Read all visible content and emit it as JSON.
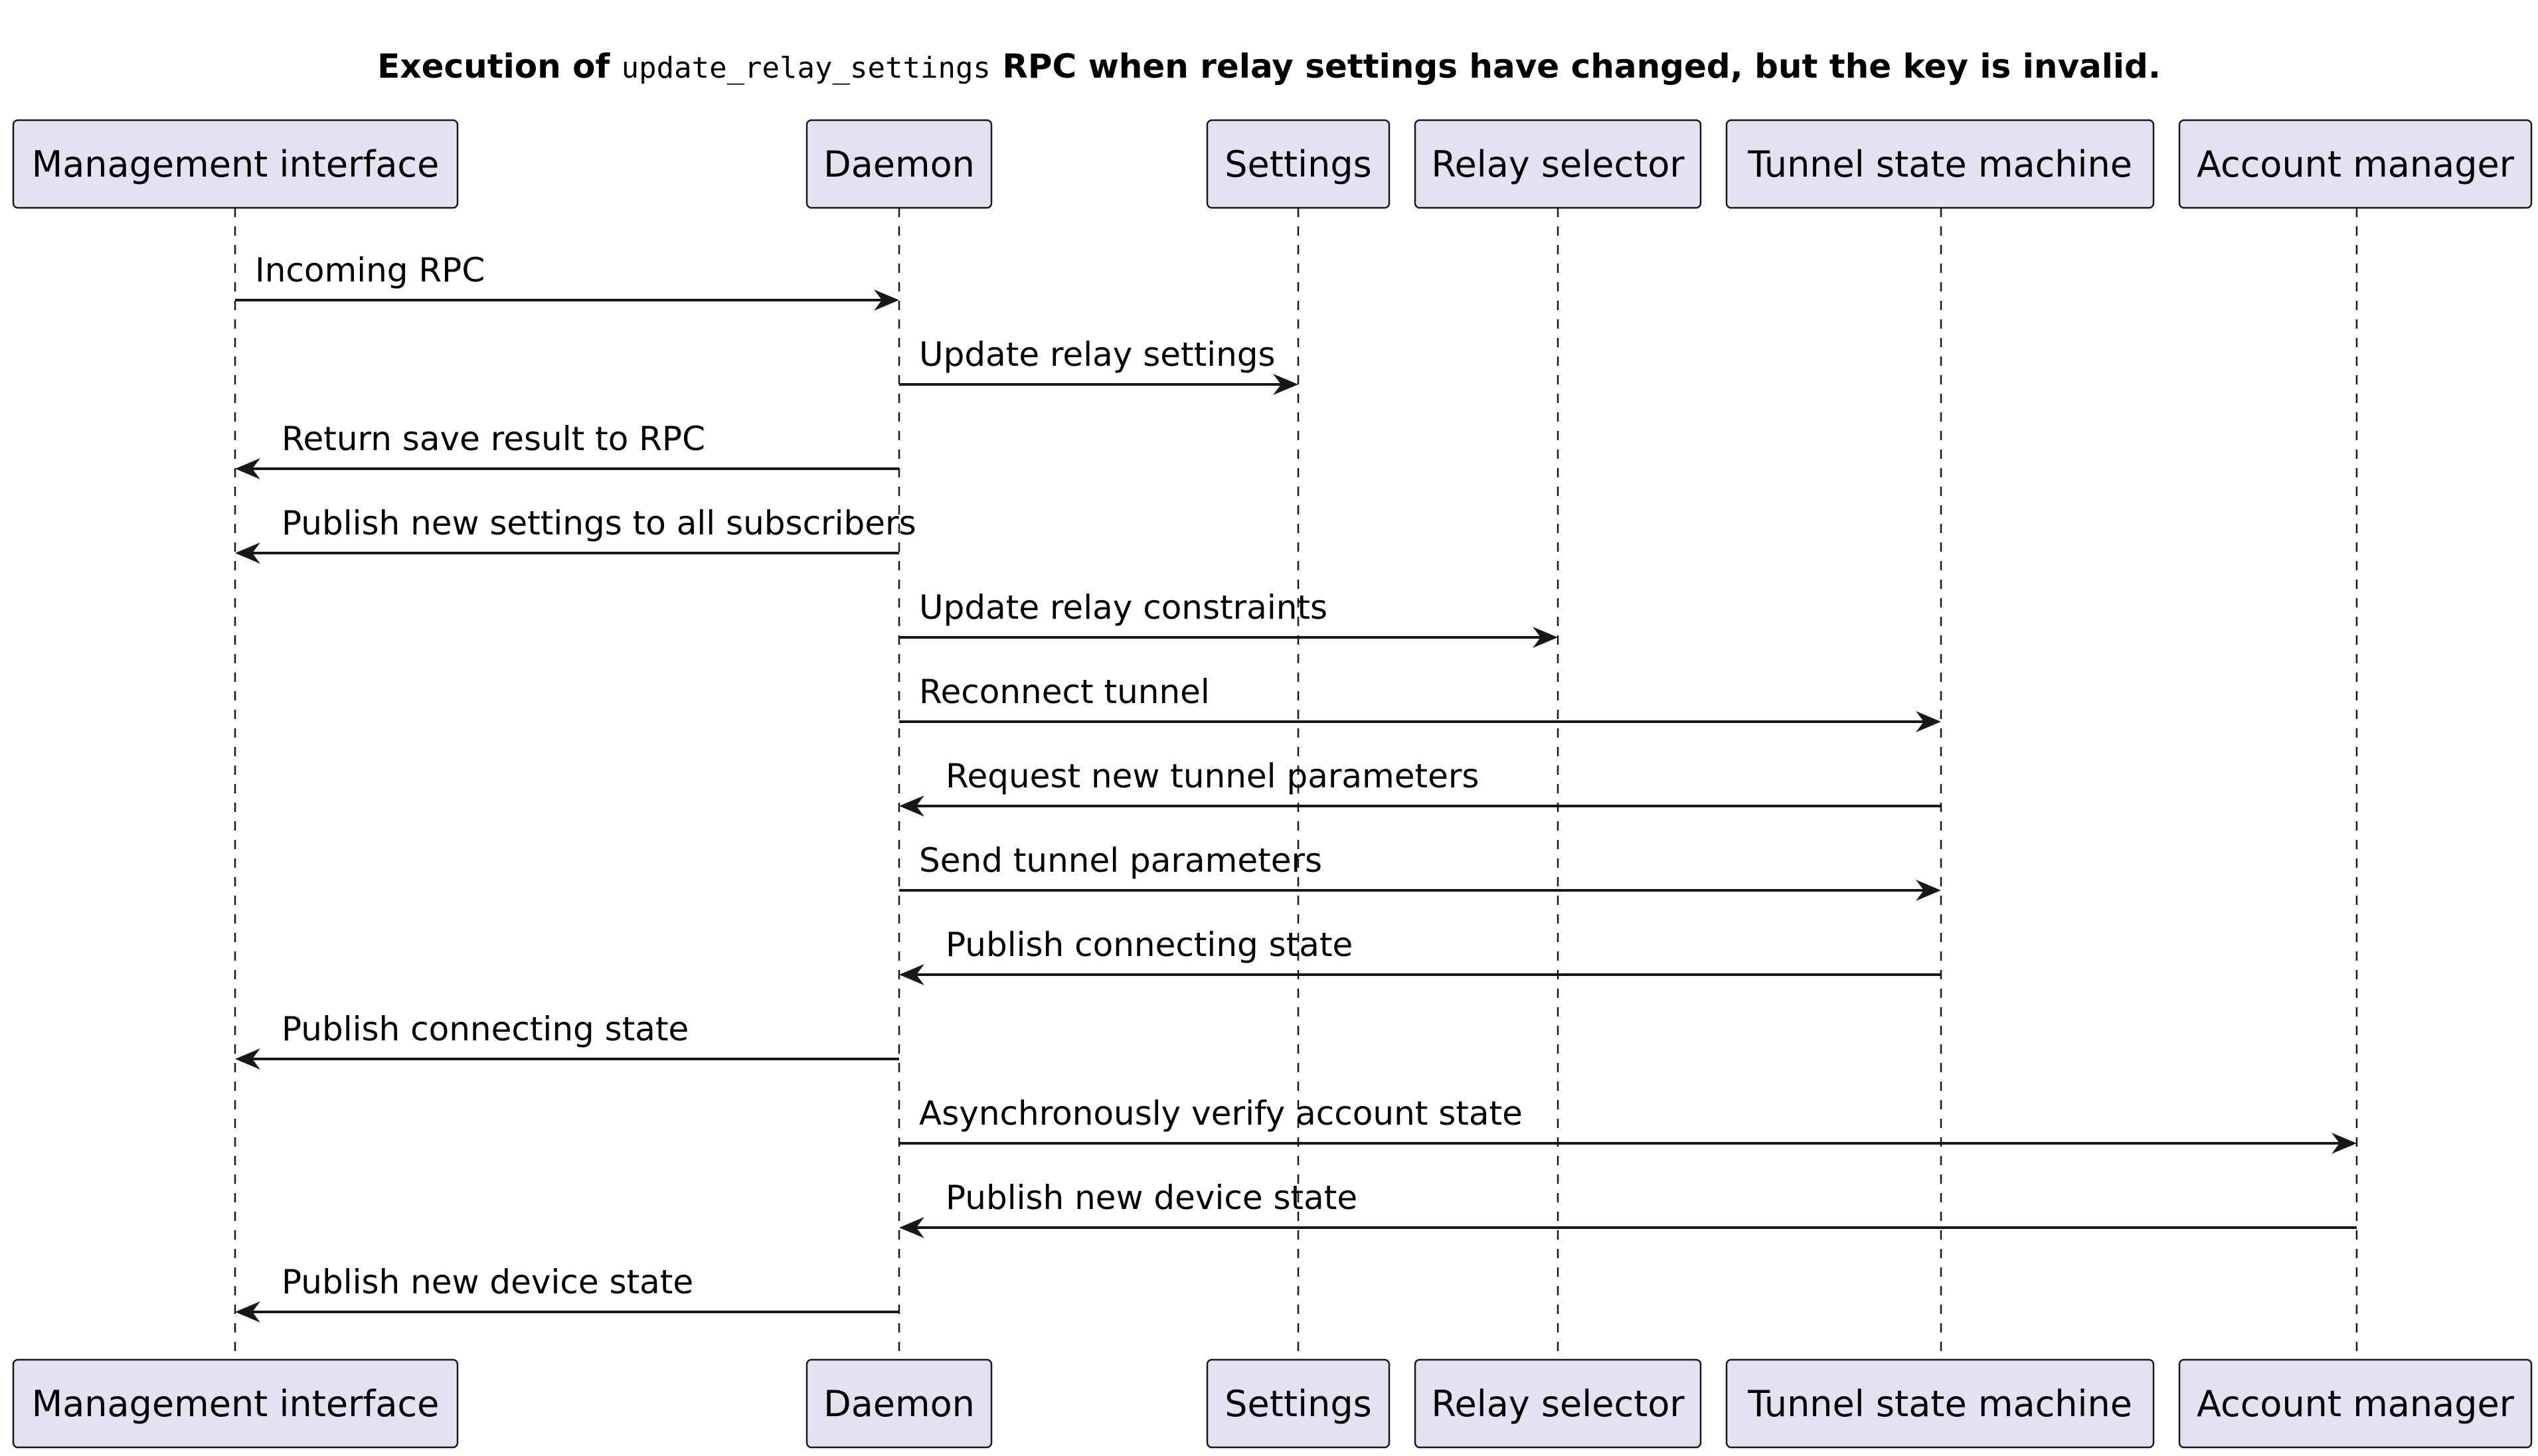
{
  "title": {
    "prefix": "Execution of ",
    "code": "update_relay_settings",
    "suffix": " RPC when relay settings have changed, but the key is invalid."
  },
  "colors": {
    "participant_fill": "#E2E2F0",
    "stroke": "#181818",
    "background": "#FFFFFF"
  },
  "participants": [
    {
      "id": "mgmt",
      "label": "Management interface"
    },
    {
      "id": "daemon",
      "label": "Daemon"
    },
    {
      "id": "settings",
      "label": "Settings"
    },
    {
      "id": "relay",
      "label": "Relay selector"
    },
    {
      "id": "tunnel",
      "label": "Tunnel state machine"
    },
    {
      "id": "account",
      "label": "Account manager"
    }
  ],
  "messages": [
    {
      "from": "mgmt",
      "to": "daemon",
      "label": "Incoming RPC"
    },
    {
      "from": "daemon",
      "to": "settings",
      "label": "Update relay settings"
    },
    {
      "from": "daemon",
      "to": "mgmt",
      "label": "Return save result to RPC"
    },
    {
      "from": "daemon",
      "to": "mgmt",
      "label": "Publish new settings to all subscribers"
    },
    {
      "from": "daemon",
      "to": "relay",
      "label": "Update relay constraints"
    },
    {
      "from": "daemon",
      "to": "tunnel",
      "label": "Reconnect tunnel"
    },
    {
      "from": "tunnel",
      "to": "daemon",
      "label": "Request new tunnel parameters"
    },
    {
      "from": "daemon",
      "to": "tunnel",
      "label": "Send tunnel parameters"
    },
    {
      "from": "tunnel",
      "to": "daemon",
      "label": "Publish connecting state"
    },
    {
      "from": "daemon",
      "to": "mgmt",
      "label": "Publish connecting state"
    },
    {
      "from": "daemon",
      "to": "account",
      "label": "Asynchronously verify account state"
    },
    {
      "from": "account",
      "to": "daemon",
      "label": "Publish new device state"
    },
    {
      "from": "daemon",
      "to": "mgmt",
      "label": "Publish new device state"
    }
  ]
}
